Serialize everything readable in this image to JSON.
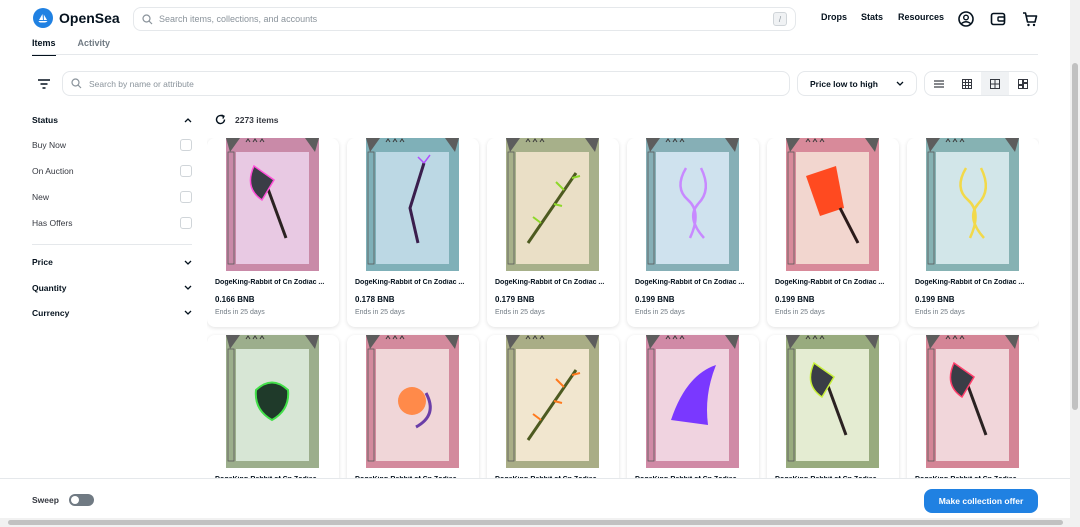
{
  "header": {
    "brand": "OpenSea",
    "search_placeholder": "Search items, collections, and accounts",
    "search_shortcut": "/",
    "nav": [
      "Drops",
      "Stats",
      "Resources"
    ]
  },
  "tabs": [
    "Items",
    "Activity"
  ],
  "toolbar": {
    "attr_search_placeholder": "Search by name or attribute",
    "sort_label": "Price low to high"
  },
  "sidebar": {
    "status_title": "Status",
    "status_options": [
      "Buy Now",
      "On Auction",
      "New",
      "Has Offers"
    ],
    "sections": [
      "Price",
      "Quantity",
      "Currency"
    ]
  },
  "results": {
    "count": "2273 items"
  },
  "cards": [
    {
      "name": "DogeKing-Rabbit of Cn Zodiac ...",
      "price": "0.166 BNB",
      "ends": "Ends in 25 days",
      "bg": "#e8c9e3",
      "frame": "#c98aa8",
      "item": "axe",
      "glow": "#ff4fd8"
    },
    {
      "name": "DogeKing-Rabbit of Cn Zodiac ...",
      "price": "0.178 BNB",
      "ends": "Ends in 25 days",
      "bg": "#bcd8e4",
      "frame": "#7fb0b8",
      "item": "staff",
      "glow": "#b04fff"
    },
    {
      "name": "DogeKing-Rabbit of Cn Zodiac ...",
      "price": "0.179 BNB",
      "ends": "Ends in 25 days",
      "bg": "#eadfc6",
      "frame": "#a7b08a",
      "item": "branch",
      "glow": "#8ed82a"
    },
    {
      "name": "DogeKing-Rabbit of Cn Zodiac ...",
      "price": "0.199 BNB",
      "ends": "Ends in 25 days",
      "bg": "#cfe2ee",
      "frame": "#86afb6",
      "item": "chain",
      "glow": "#c889ff"
    },
    {
      "name": "DogeKing-Rabbit of Cn Zodiac ...",
      "price": "0.199 BNB",
      "ends": "Ends in 25 days",
      "bg": "#f2d6cf",
      "frame": "#d88a9a",
      "item": "cleaver",
      "glow": "#ff4a20"
    },
    {
      "name": "DogeKing-Rabbit of Cn Zodiac ...",
      "price": "0.199 BNB",
      "ends": "Ends in 25 days",
      "bg": "#d2e6e9",
      "frame": "#86b2b3",
      "item": "chain",
      "glow": "#f2d94a"
    },
    {
      "name": "DogeKing-Rabbit of Cn Zodiac ...",
      "price": "",
      "ends": "",
      "bg": "#d7e6d5",
      "frame": "#9cae8c",
      "item": "mask",
      "glow": "#43e04a"
    },
    {
      "name": "DogeKing-Rabbit of Cn Zodiac ...",
      "price": "",
      "ends": "",
      "bg": "#f0d6d8",
      "frame": "#d38a9d",
      "item": "orb",
      "glow": "#ff8a4a"
    },
    {
      "name": "DogeKing-Rabbit of Cn Zodiac ...",
      "price": "",
      "ends": "",
      "bg": "#f1e6cf",
      "frame": "#a9ad86",
      "item": "branch",
      "glow": "#ff7a1e"
    },
    {
      "name": "DogeKing-Rabbit of Cn Zodiac ...",
      "price": "",
      "ends": "",
      "bg": "#f0d3e0",
      "frame": "#d08aa6",
      "item": "wing",
      "glow": "#7a38ff"
    },
    {
      "name": "DogeKing-Rabbit of Cn Zodiac ...",
      "price": "",
      "ends": "",
      "bg": "#e4ecd2",
      "frame": "#98ab7e",
      "item": "axe",
      "glow": "#c8f03a"
    },
    {
      "name": "DogeKing-Rabbit of Cn Zodiac ...",
      "price": "",
      "ends": "",
      "bg": "#f1d6da",
      "frame": "#d48596",
      "item": "axe",
      "glow": "#ff3f6b"
    }
  ],
  "bottom": {
    "sweep_label": "Sweep",
    "offer_button": "Make collection offer"
  },
  "colors": {
    "accent": "#2081e2",
    "text": "#04111d",
    "muted": "#707a83"
  }
}
